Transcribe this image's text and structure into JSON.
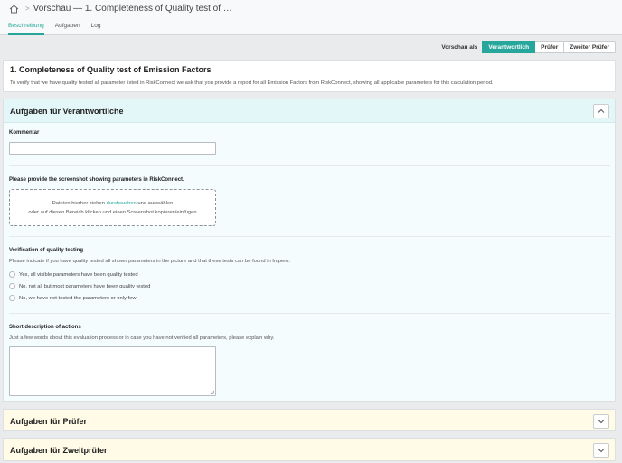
{
  "header": {
    "breadcrumb_title": "Vorschau — 1. Completeness of Quality test of …"
  },
  "tabs": [
    {
      "label": "Beschreibung",
      "active": true
    },
    {
      "label": "Aufgaben",
      "active": false
    },
    {
      "label": "Log",
      "active": false
    }
  ],
  "preview": {
    "label": "Vorschau als",
    "buttons": [
      {
        "label": "Verantwortlich",
        "active": true
      },
      {
        "label": "Prüfer",
        "active": false
      },
      {
        "label": "Zweiter Prüfer",
        "active": false
      }
    ]
  },
  "description": {
    "title": "1. Completeness of Quality test of Emission Factors",
    "text": "To verify that we have quality tested all parameter listed in RiskConnect we ask that you provide a report for all Emission Factors from RiskConnect, showing all applicable parameters for this calculation period."
  },
  "sections": {
    "responsible": {
      "title": "Aufgaben für Verantwortliche",
      "comment_label": "Kommentar",
      "comment_value": "",
      "screenshot_label": "Please provide the screenshot showing parameters in RiskConnect.",
      "dropzone_line1_pre": "Dateien hierher ziehen ",
      "dropzone_link": "durchsuchen",
      "dropzone_line1_post": " und auswählen",
      "dropzone_line2": "oder auf diesen Bereich klicken und einen Screenshot kopieren/einfügen",
      "verification_label": "Verification of quality testing",
      "verification_help": "Please indicate if you have quality tested all shown parameters in the picture and that these tests can be found in Impero.",
      "options": [
        "Yes, all visible parameters have been quality tested",
        "No, not all but most parameters have been quality tested",
        "No, we have not tested the parameters or only few"
      ],
      "actions_label": "Short description of actions",
      "actions_help": "Just a few words about this evaluation process or in case you have not verified all parameters, please explain why.",
      "actions_value": ""
    },
    "pruefer": {
      "title": "Aufgaben für Prüfer"
    },
    "zweitpruefer": {
      "title": "Aufgaben für Zweitprüfer"
    }
  },
  "colors": {
    "accent": "#27a79b",
    "responsible_bg": "#e3f7f9",
    "reviewer_bg": "#fffbe6"
  },
  "icons": {
    "home": "home-icon",
    "collapse": "chevron-up-icon",
    "expand": "chevron-down-icon"
  }
}
